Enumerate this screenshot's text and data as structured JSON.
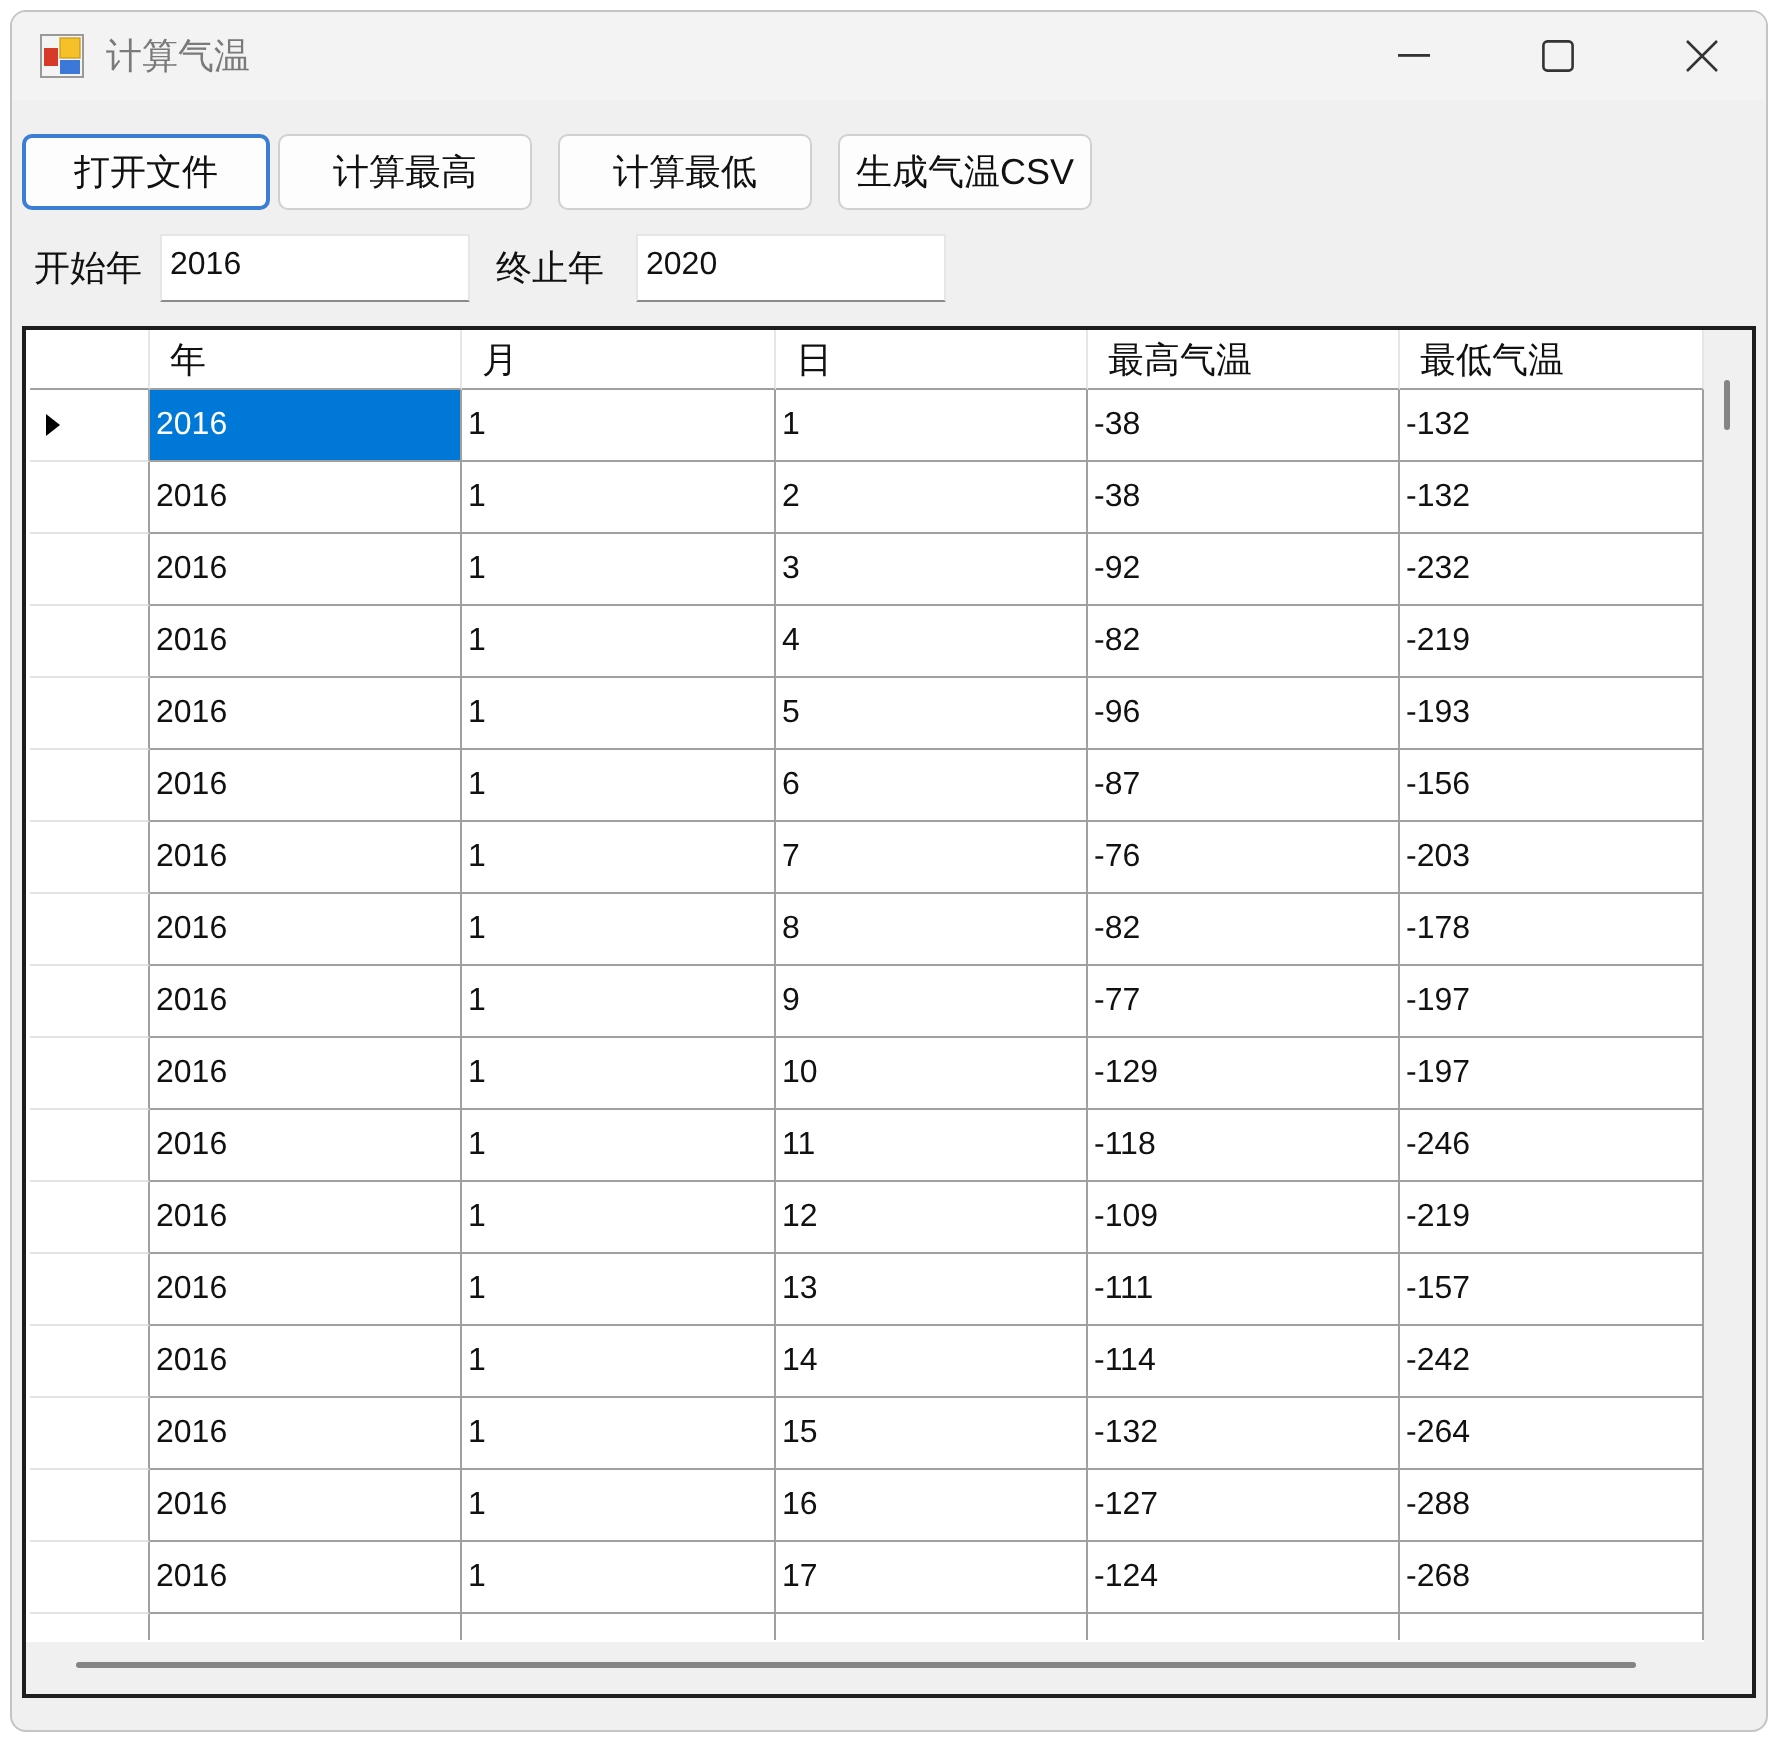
{
  "window": {
    "title": "计算气温"
  },
  "toolbar": [
    {
      "label": "打开文件",
      "focused": true
    },
    {
      "label": "计算最高",
      "focused": false
    },
    {
      "label": "计算最低",
      "focused": false
    },
    {
      "label": "生成气温CSV",
      "focused": false
    }
  ],
  "range_fields": [
    {
      "label": "开始年",
      "value": "2016"
    },
    {
      "label": "终止年",
      "value": "2020"
    }
  ],
  "table": {
    "columns": [
      "年",
      "月",
      "日",
      "最高气温",
      "最低气温"
    ],
    "rows": [
      {
        "current": true,
        "cells": [
          {
            "text": "2016",
            "selected": true
          },
          {
            "text": "1",
            "selected": false
          },
          {
            "text": "1",
            "selected": false
          },
          {
            "text": "-38",
            "selected": false
          },
          {
            "text": "-132",
            "selected": false
          }
        ]
      },
      {
        "current": false,
        "cells": [
          {
            "text": "2016",
            "selected": false
          },
          {
            "text": "1",
            "selected": false
          },
          {
            "text": "2",
            "selected": false
          },
          {
            "text": "-38",
            "selected": false
          },
          {
            "text": "-132",
            "selected": false
          }
        ]
      },
      {
        "current": false,
        "cells": [
          {
            "text": "2016",
            "selected": false
          },
          {
            "text": "1",
            "selected": false
          },
          {
            "text": "3",
            "selected": false
          },
          {
            "text": "-92",
            "selected": false
          },
          {
            "text": "-232",
            "selected": false
          }
        ]
      },
      {
        "current": false,
        "cells": [
          {
            "text": "2016",
            "selected": false
          },
          {
            "text": "1",
            "selected": false
          },
          {
            "text": "4",
            "selected": false
          },
          {
            "text": "-82",
            "selected": false
          },
          {
            "text": "-219",
            "selected": false
          }
        ]
      },
      {
        "current": false,
        "cells": [
          {
            "text": "2016",
            "selected": false
          },
          {
            "text": "1",
            "selected": false
          },
          {
            "text": "5",
            "selected": false
          },
          {
            "text": "-96",
            "selected": false
          },
          {
            "text": "-193",
            "selected": false
          }
        ]
      },
      {
        "current": false,
        "cells": [
          {
            "text": "2016",
            "selected": false
          },
          {
            "text": "1",
            "selected": false
          },
          {
            "text": "6",
            "selected": false
          },
          {
            "text": "-87",
            "selected": false
          },
          {
            "text": "-156",
            "selected": false
          }
        ]
      },
      {
        "current": false,
        "cells": [
          {
            "text": "2016",
            "selected": false
          },
          {
            "text": "1",
            "selected": false
          },
          {
            "text": "7",
            "selected": false
          },
          {
            "text": "-76",
            "selected": false
          },
          {
            "text": "-203",
            "selected": false
          }
        ]
      },
      {
        "current": false,
        "cells": [
          {
            "text": "2016",
            "selected": false
          },
          {
            "text": "1",
            "selected": false
          },
          {
            "text": "8",
            "selected": false
          },
          {
            "text": "-82",
            "selected": false
          },
          {
            "text": "-178",
            "selected": false
          }
        ]
      },
      {
        "current": false,
        "cells": [
          {
            "text": "2016",
            "selected": false
          },
          {
            "text": "1",
            "selected": false
          },
          {
            "text": "9",
            "selected": false
          },
          {
            "text": "-77",
            "selected": false
          },
          {
            "text": "-197",
            "selected": false
          }
        ]
      },
      {
        "current": false,
        "cells": [
          {
            "text": "2016",
            "selected": false
          },
          {
            "text": "1",
            "selected": false
          },
          {
            "text": "10",
            "selected": false
          },
          {
            "text": "-129",
            "selected": false
          },
          {
            "text": "-197",
            "selected": false
          }
        ]
      },
      {
        "current": false,
        "cells": [
          {
            "text": "2016",
            "selected": false
          },
          {
            "text": "1",
            "selected": false
          },
          {
            "text": "11",
            "selected": false
          },
          {
            "text": "-118",
            "selected": false
          },
          {
            "text": "-246",
            "selected": false
          }
        ]
      },
      {
        "current": false,
        "cells": [
          {
            "text": "2016",
            "selected": false
          },
          {
            "text": "1",
            "selected": false
          },
          {
            "text": "12",
            "selected": false
          },
          {
            "text": "-109",
            "selected": false
          },
          {
            "text": "-219",
            "selected": false
          }
        ]
      },
      {
        "current": false,
        "cells": [
          {
            "text": "2016",
            "selected": false
          },
          {
            "text": "1",
            "selected": false
          },
          {
            "text": "13",
            "selected": false
          },
          {
            "text": "-111",
            "selected": false
          },
          {
            "text": "-157",
            "selected": false
          }
        ]
      },
      {
        "current": false,
        "cells": [
          {
            "text": "2016",
            "selected": false
          },
          {
            "text": "1",
            "selected": false
          },
          {
            "text": "14",
            "selected": false
          },
          {
            "text": "-114",
            "selected": false
          },
          {
            "text": "-242",
            "selected": false
          }
        ]
      },
      {
        "current": false,
        "cells": [
          {
            "text": "2016",
            "selected": false
          },
          {
            "text": "1",
            "selected": false
          },
          {
            "text": "15",
            "selected": false
          },
          {
            "text": "-132",
            "selected": false
          },
          {
            "text": "-264",
            "selected": false
          }
        ]
      },
      {
        "current": false,
        "cells": [
          {
            "text": "2016",
            "selected": false
          },
          {
            "text": "1",
            "selected": false
          },
          {
            "text": "16",
            "selected": false
          },
          {
            "text": "-127",
            "selected": false
          },
          {
            "text": "-288",
            "selected": false
          }
        ]
      },
      {
        "current": false,
        "cells": [
          {
            "text": "2016",
            "selected": false
          },
          {
            "text": "1",
            "selected": false
          },
          {
            "text": "17",
            "selected": false
          },
          {
            "text": "-124",
            "selected": false
          },
          {
            "text": "-268",
            "selected": false
          }
        ]
      }
    ]
  }
}
